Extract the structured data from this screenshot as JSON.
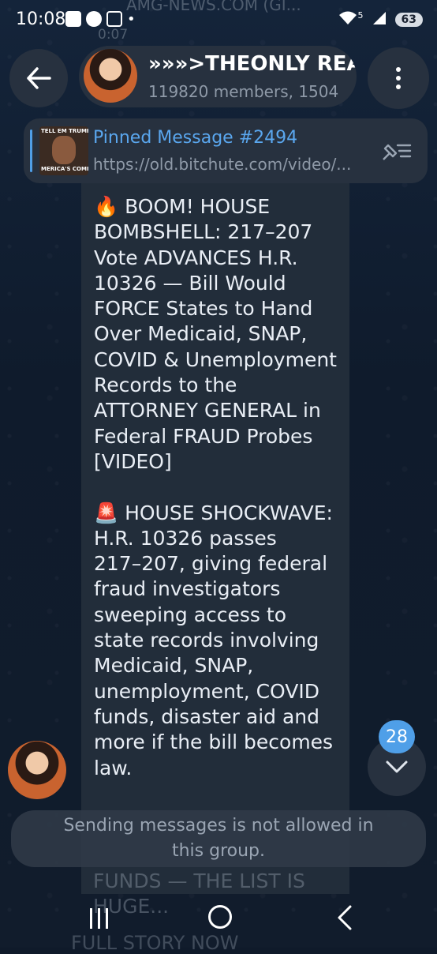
{
  "status_bar": {
    "time": "10:08",
    "ghost_title": "AMG-NEWS.COM (GI...",
    "ghost_timer": "0:07",
    "network": "5",
    "battery": "63"
  },
  "header": {
    "title": "»»»>THEONLY REA",
    "subtitle": "119820 members, 1504"
  },
  "pinned": {
    "title": "Pinned Message #2494",
    "link": "https://old.bitchute.com/video/...",
    "thumb_top": "TELL EM TRUMP'S COM",
    "thumb_bottom": "MERICA'S COMING WIT"
  },
  "message": {
    "text": "🔥 BOOM! HOUSE\nBOMBSHELL: 217–207\nVote ADVANCES H.R.\n10326 — Bill Would\nFORCE States to Hand\nOver Medicaid, SNAP,\nCOVID & Unemployment\nRecords to the\nATTORNEY GENERAL in\nFederal FRAUD Probes\n[VIDEO]\n\n🚨 HOUSE SHOCKWAVE:\nH.R. 10326 passes\n217–207, giving federal\nfraud investigators\nsweeping access to\nstate records involving\nMedicaid, SNAP,\nunemployment, COVID\nfunds, disaster aid and\nmore if the bill becomes\nlaw.",
    "trailing": "FUNDS — THE LIST IS\nHUGE...",
    "footer_ghost": "FULL STORY NOW"
  },
  "scroll": {
    "unread_count": "28"
  },
  "notice": {
    "text": "Sending messages is not allowed in this group."
  },
  "colors": {
    "accent": "#4f9fe8",
    "bubble": "#222d3a",
    "background": "#0f1a2a"
  }
}
